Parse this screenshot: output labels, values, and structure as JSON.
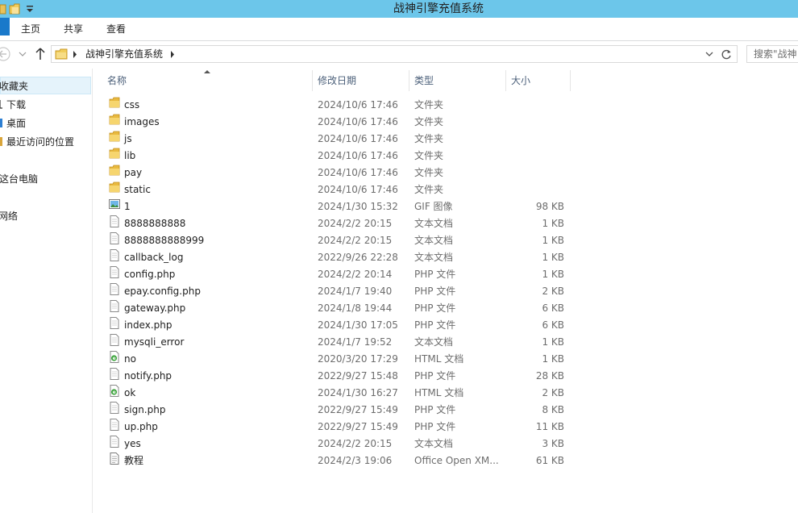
{
  "window": {
    "title": "战神引擎充值系统"
  },
  "ribbon": {
    "tabs": [
      "主页",
      "共享",
      "查看"
    ]
  },
  "address": {
    "crumb": "战神引擎充值系统"
  },
  "search": {
    "placeholder": "搜索\"战神"
  },
  "nav": {
    "items": [
      "收藏夹",
      "下载",
      "桌面",
      "最近访问的位置",
      "这台电脑",
      "网络"
    ]
  },
  "columns": {
    "name": "名称",
    "date": "修改日期",
    "type": "类型",
    "size": "大小"
  },
  "files": [
    {
      "name": "css",
      "date": "2024/10/6 17:46",
      "type": "文件夹",
      "size": "",
      "icon": "folder-icon"
    },
    {
      "name": "images",
      "date": "2024/10/6 17:46",
      "type": "文件夹",
      "size": "",
      "icon": "folder-icon"
    },
    {
      "name": "js",
      "date": "2024/10/6 17:46",
      "type": "文件夹",
      "size": "",
      "icon": "folder-icon"
    },
    {
      "name": "lib",
      "date": "2024/10/6 17:46",
      "type": "文件夹",
      "size": "",
      "icon": "folder-icon"
    },
    {
      "name": "pay",
      "date": "2024/10/6 17:46",
      "type": "文件夹",
      "size": "",
      "icon": "folder-icon"
    },
    {
      "name": "static",
      "date": "2024/10/6 17:46",
      "type": "文件夹",
      "size": "",
      "icon": "folder-icon"
    },
    {
      "name": "1",
      "date": "2024/1/30 15:32",
      "type": "GIF 图像",
      "size": "98 KB",
      "icon": "image-file-icon"
    },
    {
      "name": "8888888888",
      "date": "2024/2/2 20:15",
      "type": "文本文档",
      "size": "1 KB",
      "icon": "text-file-icon"
    },
    {
      "name": "8888888888999",
      "date": "2024/2/2 20:15",
      "type": "文本文档",
      "size": "1 KB",
      "icon": "text-file-icon"
    },
    {
      "name": "callback_log",
      "date": "2022/9/26 22:28",
      "type": "文本文档",
      "size": "1 KB",
      "icon": "text-file-icon"
    },
    {
      "name": "config.php",
      "date": "2024/2/2 20:14",
      "type": "PHP 文件",
      "size": "1 KB",
      "icon": "text-file-icon"
    },
    {
      "name": "epay.config.php",
      "date": "2024/1/7 19:40",
      "type": "PHP 文件",
      "size": "2 KB",
      "icon": "text-file-icon"
    },
    {
      "name": "gateway.php",
      "date": "2024/1/8 19:44",
      "type": "PHP 文件",
      "size": "6 KB",
      "icon": "text-file-icon"
    },
    {
      "name": "index.php",
      "date": "2024/1/30 17:05",
      "type": "PHP 文件",
      "size": "6 KB",
      "icon": "text-file-icon"
    },
    {
      "name": "mysqli_error",
      "date": "2024/1/7 19:52",
      "type": "文本文档",
      "size": "1 KB",
      "icon": "text-file-icon"
    },
    {
      "name": "no",
      "date": "2020/3/20 17:29",
      "type": "HTML 文档",
      "size": "1 KB",
      "icon": "html-file-icon"
    },
    {
      "name": "notify.php",
      "date": "2022/9/27 15:48",
      "type": "PHP 文件",
      "size": "28 KB",
      "icon": "text-file-icon"
    },
    {
      "name": "ok",
      "date": "2024/1/30 16:27",
      "type": "HTML 文档",
      "size": "2 KB",
      "icon": "html-file-icon"
    },
    {
      "name": "sign.php",
      "date": "2022/9/27 15:49",
      "type": "PHP 文件",
      "size": "8 KB",
      "icon": "text-file-icon"
    },
    {
      "name": "up.php",
      "date": "2022/9/27 15:49",
      "type": "PHP 文件",
      "size": "11 KB",
      "icon": "text-file-icon"
    },
    {
      "name": "yes",
      "date": "2024/2/2 20:15",
      "type": "文本文档",
      "size": "3 KB",
      "icon": "text-file-icon"
    },
    {
      "name": "教程",
      "date": "2024/2/3 19:06",
      "type": "Office Open XM...",
      "size": "61 KB",
      "icon": "document-file-icon"
    }
  ]
}
